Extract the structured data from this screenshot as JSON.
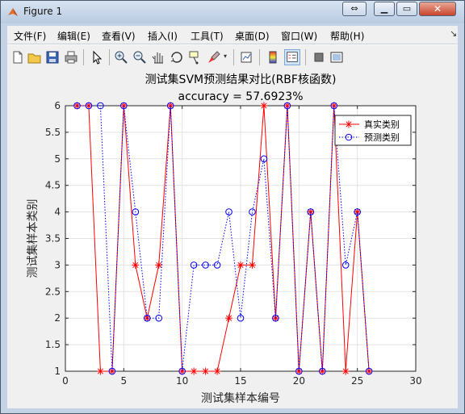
{
  "window": {
    "title": "Figure 1",
    "restore_icon": "restore-arrows-icon",
    "minimize_icon": "minimize-icon",
    "maximize_icon": "maximize-icon",
    "close_icon": "close-x-icon"
  },
  "menubar": {
    "items": [
      "文件(F)",
      "编辑(E)",
      "查看(V)",
      "插入(I)",
      "工具(T)",
      "桌面(D)",
      "窗口(W)",
      "帮助(H)"
    ]
  },
  "toolbar": {
    "icons": [
      "new-figure-icon",
      "open-file-icon",
      "save-icon",
      "print-icon",
      "edit-plot-arrow-icon",
      "zoom-in-icon",
      "zoom-out-icon",
      "pan-hand-icon",
      "rotate-3d-icon",
      "data-cursor-icon",
      "brush-icon",
      "link-plot-icon",
      "colorbar-icon",
      "legend-icon",
      "hide-plot-tools-icon",
      "show-plot-tools-icon"
    ]
  },
  "colors": {
    "true_series": "#ff0000",
    "pred_series": "#0000ff",
    "axes_bg": "#ffffff",
    "figure_bg": "#f0f0f0"
  },
  "chart_data": {
    "type": "line",
    "title": "测试集SVM预测结果对比(RBF核函数)",
    "subtitle": "accuracy = 57.6923%",
    "xlabel": "测试集样本编号",
    "ylabel": "测试集样本类别",
    "xlim": [
      0,
      30
    ],
    "ylim": [
      1,
      6
    ],
    "xticks": [
      0,
      5,
      10,
      15,
      20,
      25,
      30
    ],
    "yticks": [
      1,
      1.5,
      2,
      2.5,
      3,
      3.5,
      4,
      4.5,
      5,
      5.5,
      6
    ],
    "grid": true,
    "legend_position": "top-right",
    "x": [
      1,
      2,
      3,
      4,
      5,
      6,
      7,
      8,
      9,
      10,
      11,
      12,
      13,
      14,
      15,
      16,
      17,
      18,
      19,
      20,
      21,
      22,
      23,
      24,
      25,
      26
    ],
    "series": [
      {
        "name": "真实类别",
        "color": "#ff0000",
        "marker": "asterisk",
        "line": "solid",
        "values": [
          6,
          6,
          1,
          1,
          6,
          3,
          2,
          3,
          6,
          1,
          1,
          1,
          1,
          2,
          3,
          3,
          6,
          2,
          6,
          1,
          4,
          1,
          6,
          1,
          4,
          1
        ]
      },
      {
        "name": "预测类别",
        "color": "#0000ff",
        "marker": "circle",
        "line": "dotted",
        "values": [
          6,
          6,
          6,
          1,
          6,
          4,
          2,
          2,
          6,
          1,
          3,
          3,
          3,
          4,
          2,
          4,
          5,
          2,
          6,
          1,
          4,
          1,
          6,
          3,
          4,
          1
        ]
      }
    ]
  }
}
